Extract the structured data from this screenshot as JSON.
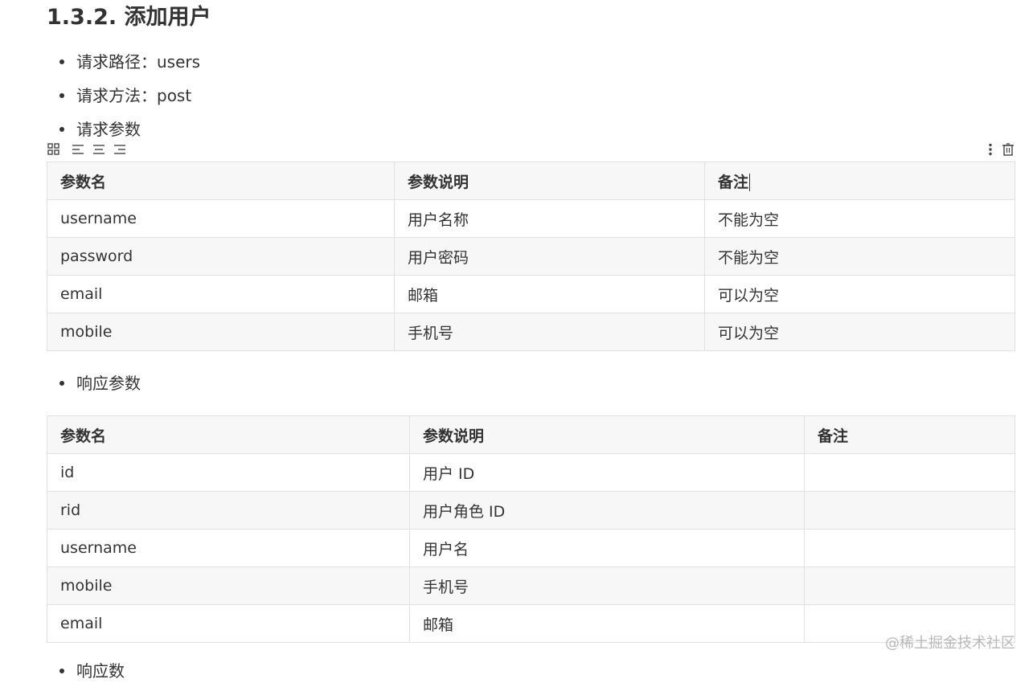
{
  "section": {
    "heading": "1.3.2. 添加用户"
  },
  "bullets": {
    "path": "请求路径：users",
    "method": "请求方法：post",
    "request_params": "请求参数",
    "response_params": "响应参数",
    "next_partial": "响应数"
  },
  "toolbar": {
    "icons": [
      "grid-icon",
      "align-left-icon",
      "align-center-icon",
      "align-right-icon",
      "more-vertical-icon",
      "trash-icon"
    ]
  },
  "request_table": {
    "headers": [
      "参数名",
      "参数说明",
      "备注"
    ],
    "rows": [
      [
        "username",
        "用户名称",
        "不能为空"
      ],
      [
        "password",
        "用户密码",
        "不能为空"
      ],
      [
        "email",
        "邮箱",
        "可以为空"
      ],
      [
        "mobile",
        "手机号",
        "可以为空"
      ]
    ]
  },
  "response_table": {
    "headers": [
      "参数名",
      "参数说明",
      "备注"
    ],
    "rows": [
      [
        "id",
        "用户 ID",
        ""
      ],
      [
        "rid",
        "用户角色 ID",
        ""
      ],
      [
        "username",
        "用户名",
        ""
      ],
      [
        "mobile",
        "手机号",
        ""
      ],
      [
        "email",
        "邮箱",
        ""
      ]
    ]
  },
  "watermark": "@稀土掘金技术社区",
  "colors": {
    "text": "#333333",
    "border": "#dfe2e5",
    "stripe": "#f7f7f7",
    "watermark": "#b8b8b8"
  }
}
